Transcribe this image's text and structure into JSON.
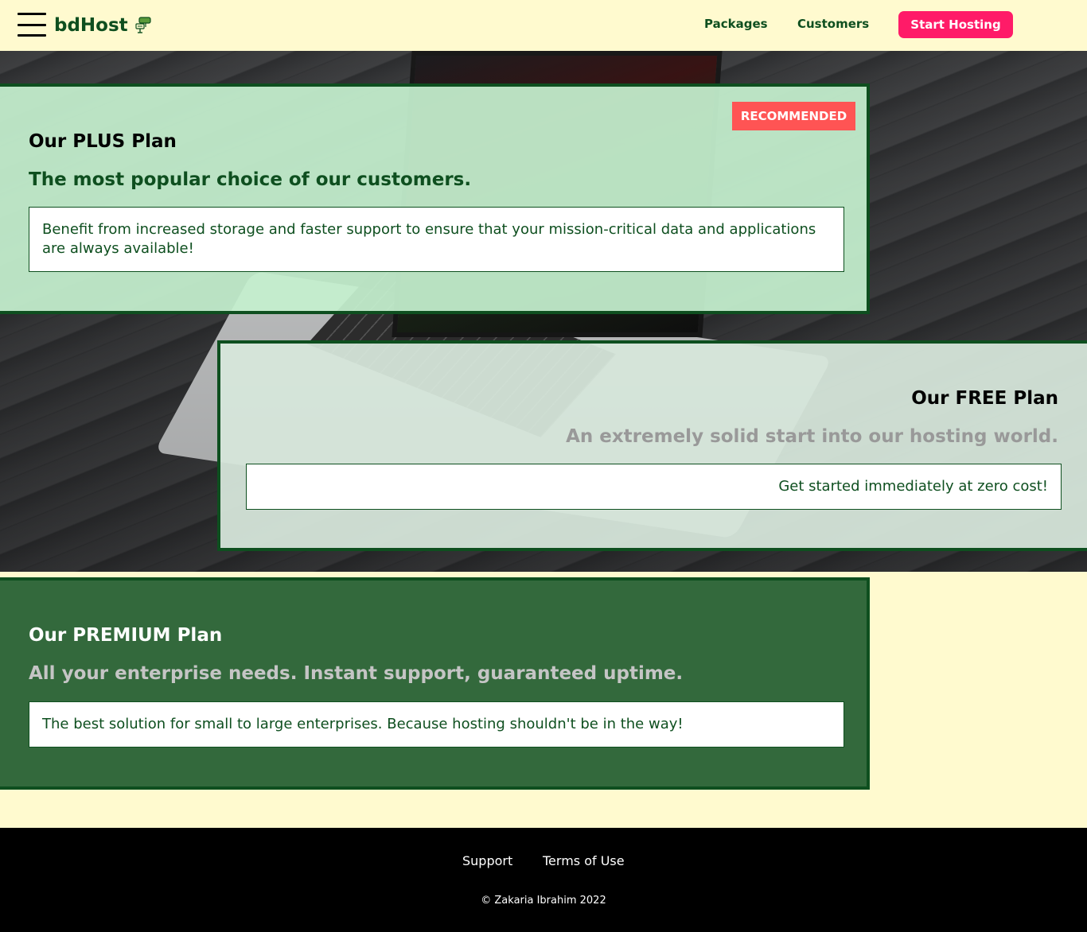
{
  "header": {
    "brand": "bdHost",
    "nav": {
      "packages": "Packages",
      "customers": "Customers"
    },
    "cta": "Start Hosting"
  },
  "plans": [
    {
      "title": "Our PLUS Plan",
      "subtitle": "The most popular choice of our customers.",
      "description": "Benefit from increased storage and faster support to ensure that your mission-critical data and applications are always available!",
      "badge": "RECOMMENDED"
    },
    {
      "title": "Our FREE Plan",
      "subtitle": "An extremely solid start into our hosting world.",
      "description": "Get started immediately at zero cost!"
    },
    {
      "title": "Our PREMIUM Plan",
      "subtitle": "All your enterprise needs. Instant support, guaranteed uptime.",
      "description": "The best solution for small to large enterprises. Because hosting shouldn't be in the way!"
    }
  ],
  "footer": {
    "links": {
      "support": "Support",
      "terms": "Terms of Use"
    },
    "copyright": "© Zakaria Ibrahim 2022"
  },
  "colors": {
    "brand_green": "#0e4f1f",
    "cta_pink": "#ff1b68",
    "badge_red": "#ff5454",
    "page_bg": "#fffacf",
    "premium_bg": "#33693c"
  },
  "icons": {
    "menu": "hamburger-menu-icon",
    "brand": "server-logo-icon"
  }
}
